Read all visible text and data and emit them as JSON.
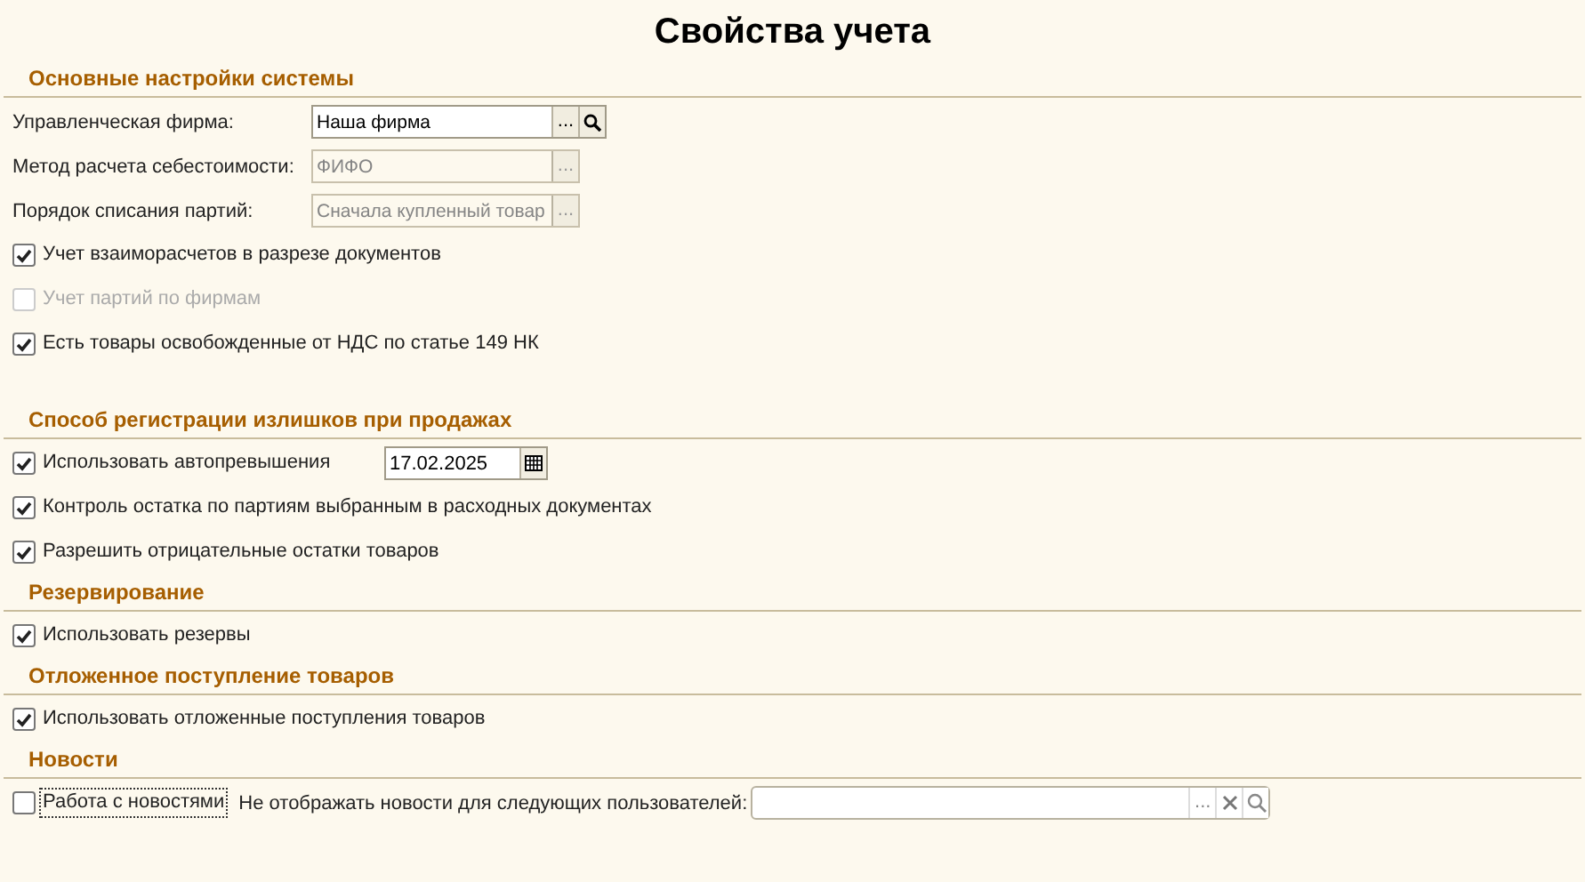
{
  "title": "Свойства учета",
  "sections": [
    {
      "title": "Основные настройки системы",
      "rows": [
        {
          "kind": "field",
          "label": "Управленческая фирма:",
          "value": "Наша фирма",
          "disabled": false,
          "select_button": "...",
          "search": true
        },
        {
          "kind": "field",
          "label": "Метод расчета себестоимости:",
          "value": "ФИФО",
          "disabled": true,
          "select_button": "..."
        },
        {
          "kind": "field",
          "label": "Порядок списания партий:",
          "value": "Сначала купленный товар",
          "disabled": true,
          "select_button": "..."
        },
        {
          "kind": "checkbox",
          "label": "Учет взаиморасчетов в разрезе документов",
          "checked": true,
          "disabled": false
        },
        {
          "kind": "checkbox",
          "label": "Учет партий по фирмам",
          "checked": false,
          "disabled": true
        },
        {
          "kind": "checkbox",
          "label": "Есть товары освобожденные от НДС по статье 149 НК",
          "checked": true,
          "disabled": false
        }
      ]
    },
    {
      "title": "Способ регистрации излишков при продажах",
      "rows": [
        {
          "kind": "checkbox_date",
          "label": "Использовать автопревышения",
          "checked": true,
          "disabled": false,
          "date": "17.02.2025"
        },
        {
          "kind": "checkbox",
          "label": "Контроль остатка по партиям выбранным в расходных документах",
          "checked": true,
          "disabled": false
        },
        {
          "kind": "checkbox",
          "label": "Разрешить отрицательные остатки товаров",
          "checked": true,
          "disabled": false
        }
      ]
    },
    {
      "title": "Резервирование",
      "rows": [
        {
          "kind": "checkbox",
          "label": "Использовать резервы",
          "checked": true,
          "disabled": false
        }
      ]
    },
    {
      "title": "Отложенное поступление товаров",
      "rows": [
        {
          "kind": "checkbox",
          "label": "Использовать отложенные поступления товаров",
          "checked": true,
          "disabled": false
        }
      ]
    },
    {
      "title": "Новости",
      "rows": [
        {
          "kind": "checkbox_filter",
          "label": "Работа с новостями",
          "checked": false,
          "disabled": false,
          "focused": true,
          "filter_label": "Не отображать новости для следующих пользователей:",
          "select_button": "...",
          "clear": true,
          "search": true
        }
      ]
    }
  ]
}
